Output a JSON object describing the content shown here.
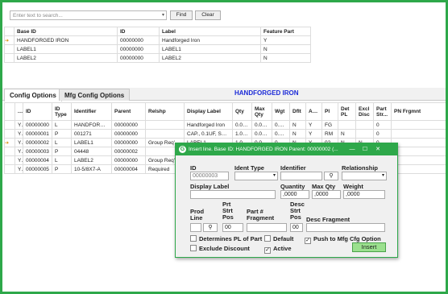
{
  "search": {
    "placeholder": "Enter text to search...",
    "find_label": "Find",
    "clear_label": "Clear"
  },
  "top_grid": {
    "headers": [
      "Base ID",
      "ID",
      "Label",
      "Feature Part"
    ],
    "rows": [
      {
        "current": true,
        "cells": [
          "HANDFORGED IRON",
          "00000000",
          "Handforged Iron",
          "Y"
        ]
      },
      {
        "current": false,
        "cells": [
          "LABEL1",
          "00000000",
          "LABEL1",
          "N"
        ]
      },
      {
        "current": false,
        "cells": [
          "LABEL2",
          "00000000",
          "LABEL2",
          "N"
        ]
      }
    ]
  },
  "tabs": [
    {
      "label": "Config Options",
      "active": true
    },
    {
      "label": "Mfg Config Options",
      "active": false
    }
  ],
  "config_title": "HANDFORGED IRON",
  "config_grid": {
    "headers": [
      "..",
      "ID",
      "ID Type",
      "Identifier",
      "Parent",
      "Relshp",
      "Display Label",
      "Qty",
      "Max Qty",
      "Wgt",
      "Dflt",
      "Actv",
      "Pl",
      "Det PL",
      "Excl Disc",
      "Part Str...",
      "PN Frgmnt"
    ],
    "rows": [
      {
        "current": false,
        "cells": [
          "Y",
          "00000000",
          "L",
          "HANDFORGE...",
          "00000000",
          "",
          "Handforged Iron",
          "0.00...",
          "0.0000",
          "0.0000",
          "N",
          "Y",
          "FG",
          "",
          "",
          "0",
          ""
        ]
      },
      {
        "current": false,
        "cells": [
          "Y",
          "00000001",
          "P",
          "001271",
          "00000000",
          "",
          "CAP., 0.1UF, SMT...",
          "1.00...",
          "0.0000",
          "0.0000",
          "N",
          "Y",
          "RM",
          "N",
          "",
          "0",
          ""
        ]
      },
      {
        "current": true,
        "cells": [
          "Y",
          "00000002",
          "L",
          "LABEL1",
          "00000000",
          "Group Req'd S...",
          "LABEL1",
          "1.00...",
          "0.0000",
          "0.0000",
          "N",
          "Y",
          "02",
          "N",
          "N",
          "0",
          ""
        ]
      },
      {
        "current": false,
        "cells": [
          "Y",
          "00000003",
          "P",
          "04448",
          "00000002",
          "",
          "",
          "",
          "",
          "",
          "",
          "",
          "",
          "",
          "",
          "",
          ""
        ]
      },
      {
        "current": false,
        "cells": [
          "Y",
          "00000004",
          "L",
          "LABEL2",
          "00000000",
          "Group Req'd",
          "",
          "",
          "",
          "",
          "",
          "",
          "",
          "",
          "",
          "",
          ""
        ]
      },
      {
        "current": false,
        "cells": [
          "Y",
          "00000005",
          "P",
          "10-5/8X7-A",
          "00000004",
          "Required",
          "",
          "",
          "",
          "",
          "",
          "",
          "",
          "",
          "",
          "",
          ""
        ]
      }
    ]
  },
  "dialog": {
    "title": "Insert line.  Base ID: HANDFORGED IRON  Parent: 00000002 (...",
    "id_label": "ID",
    "id_value": "00000003",
    "ident_type_label": "Ident Type",
    "identifier_label": "Identifier",
    "relationship_label": "Relationship",
    "display_label_label": "Display Label",
    "quantity_label": "Quantity",
    "quantity_value": ",0000",
    "max_qty_label": "Max Qty",
    "max_qty_value": ",0000",
    "weight_label": "Weight",
    "weight_value": ",0000",
    "prod_line_label": "Prod Line",
    "prt_strt_pos_label": "Prt Strt Pos",
    "prt_strt_pos_value": "00",
    "part_fragment_label": "Part # Fragment",
    "desc_strt_pos_label": "Desc Strt Pos",
    "desc_strt_pos_value": "00",
    "desc_fragment_label": "Desc Fragment",
    "determines_pl_label": "Determines PL of Part",
    "default_label": "Default",
    "push_label": "Push to Mfg Cfg Option",
    "exclude_discount_label": "Exclude Discount",
    "active_label": "Active",
    "insert_label": "Insert",
    "checks": {
      "determines_pl": false,
      "default": false,
      "push": true,
      "exclude_discount": false,
      "active": true
    }
  },
  "colors": {
    "frame": "#2ea84a",
    "title_blue": "#1c2bd8",
    "insert_button": "#9be08e",
    "row_arrow": "#d98a00"
  }
}
